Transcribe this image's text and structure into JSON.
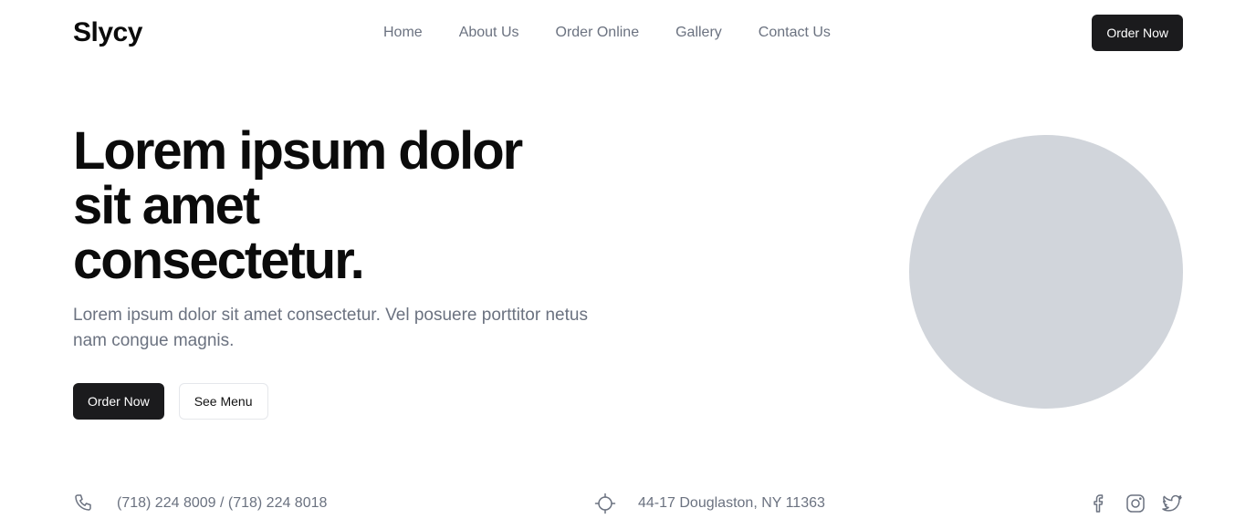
{
  "header": {
    "logo": "Slycy",
    "nav": [
      "Home",
      "About Us",
      "Order Online",
      "Gallery",
      "Contact Us"
    ],
    "cta_label": "Order Now"
  },
  "hero": {
    "title_lines": [
      "Lorem ipsum dolor",
      "sit amet",
      "consectetur."
    ],
    "subtitle": "Lorem ipsum dolor sit amet consectetur. Vel posuere porttitor netus nam congue magnis.",
    "primary_label": "Order Now",
    "secondary_label": "See Menu",
    "image_placeholder_color": "#d1d5db"
  },
  "info": {
    "phone": "(718) 224 8009 / (718) 224 8018",
    "address": "44-17 Douglaston, NY 11363",
    "icons": [
      "phone-icon",
      "location-crosshair-icon",
      "facebook-icon",
      "instagram-icon",
      "twitter-icon"
    ]
  },
  "colors": {
    "accent": "#1b1b1d",
    "muted_text": "#6b7280",
    "placeholder": "#d1d5db"
  }
}
